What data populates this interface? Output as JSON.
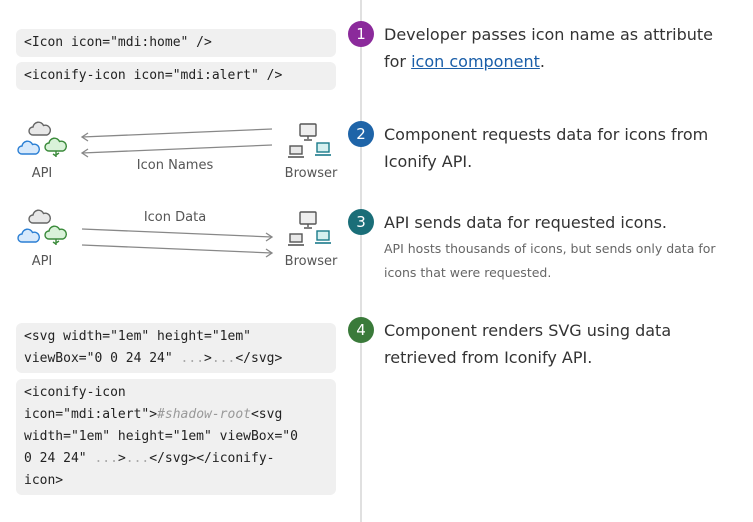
{
  "code_blocks": {
    "icon_home": "<Icon icon=\"mdi:home\" />",
    "iconify_alert": "<iconify-icon icon=\"mdi:alert\" />",
    "svg_line1": "<svg width=\"1em\" height=\"1em\"",
    "svg_line2a": "viewBox=\"0 0 24 24\" ",
    "svg_line2b": "...",
    "svg_line2c": ">",
    "svg_line2d": "...",
    "svg_line2e": "</svg>",
    "iconify_line1": "<iconify-icon",
    "iconify_line2a": "icon=\"mdi:alert\">",
    "iconify_line2b": "#shadow-root",
    "iconify_line2c": "<svg",
    "iconify_line3": "width=\"1em\" height=\"1em\" viewBox=\"0",
    "iconify_line4a": "0 24 24\" ",
    "iconify_line4b": "...",
    "iconify_line4c": ">",
    "iconify_line4d": "...",
    "iconify_line4e": "</svg></iconify-",
    "iconify_line5": "icon>"
  },
  "steps": [
    {
      "number": "1",
      "color": "#8b2a9b",
      "text_before": "Developer passes icon name as attribute for ",
      "link": "icon component",
      "text_after": "."
    },
    {
      "number": "2",
      "color": "#1e64a8",
      "text": "Component requests data for icons from Iconify API."
    },
    {
      "number": "3",
      "color": "#1a6e78",
      "text": "API sends data for requested icons.",
      "subtext": "API hosts thousands of icons, but sends only data for icons that were requested."
    },
    {
      "number": "4",
      "color": "#3a7a3a",
      "text": "Component renders SVG using data retrieved from Iconify API."
    }
  ],
  "diagram": {
    "api_label": "API",
    "browser_label": "Browser",
    "icon_names_label": "Icon Names",
    "icon_data_label": "Icon Data"
  },
  "icons": [
    "cloud-icon",
    "monitor-icon",
    "laptop-icon",
    "arrow-icon"
  ]
}
